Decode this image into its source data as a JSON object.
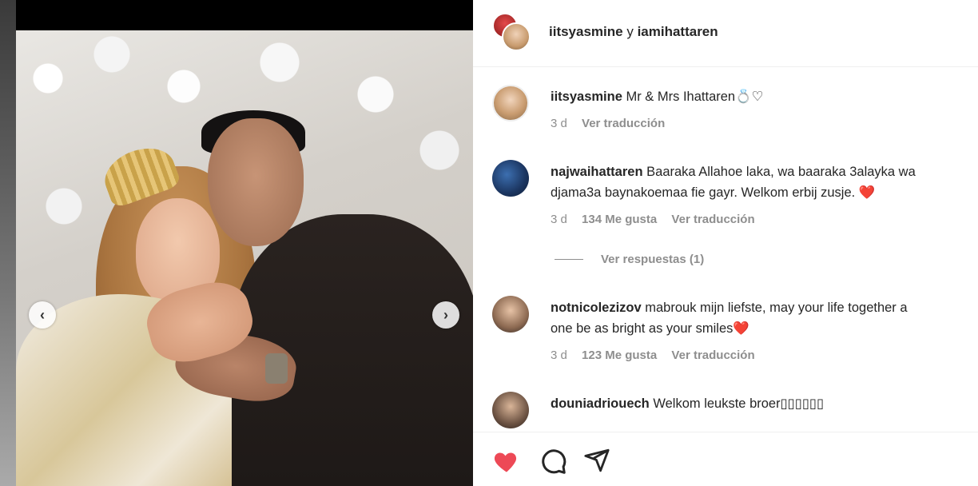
{
  "post": {
    "header_users": "iitsyasmine",
    "header_joiner": " y ",
    "header_user2": "iamihattaren"
  },
  "caption": {
    "user": "iitsyasmine",
    "text": " Mr & Mrs Ihattaren💍♡",
    "time": "3 d",
    "translate": "Ver traducción"
  },
  "comments": [
    {
      "user": "najwaihattaren",
      "line1": " Baaraka Allahoe laka, wa baaraka 3alayka wa",
      "line2": "djama3a baynakoemaa fie gayr. Welkom erbij zusje. ❤️",
      "time": "3 d",
      "likes": "134 Me gusta",
      "translate": "Ver traducción"
    },
    {
      "user": "notnicolezizov",
      "line1": " mabrouk mijn liefste, may your life together a",
      "line2": "one be as bright as your smiles❤️",
      "time": "3 d",
      "likes": "123 Me gusta",
      "translate": "Ver traducción"
    },
    {
      "user": "douniadriouech",
      "line1": " Welkom leukste broer▯▯▯▯▯▯"
    }
  ],
  "replies": "Ver respuestas (1)",
  "navigation": {
    "prev": "‹",
    "next": "›"
  },
  "icons": [
    "heart-icon",
    "comment-icon",
    "share-icon"
  ],
  "colors": {
    "like_red": "#ed4956",
    "text": "#262626",
    "muted": "#8e8e8e"
  }
}
